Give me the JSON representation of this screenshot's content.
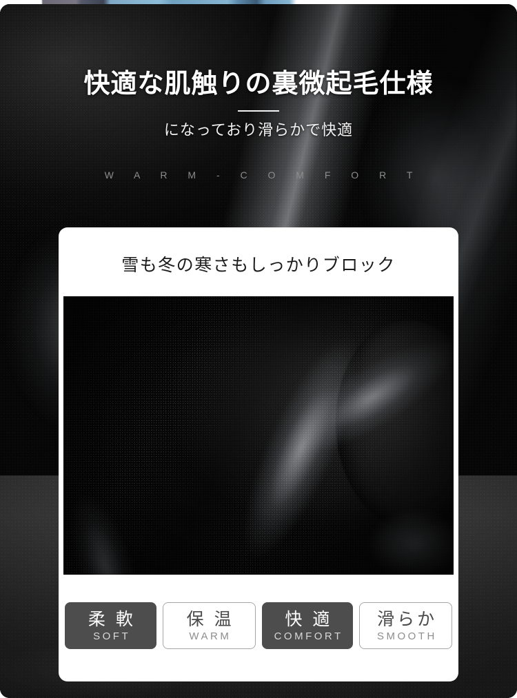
{
  "top_strip": {
    "description": "previous-image-sliver"
  },
  "hero": {
    "headline": "快適な肌触りの裏微起毛仕様",
    "subheadline": "になっており滑らかで快適",
    "eyebrow": "W A R M - C O M F O R T",
    "background_color": "#0b0b0b"
  },
  "card": {
    "title": "雪も冬の寒さもしっかりブロック",
    "background_color": "#ffffff",
    "photo_alt": "black-fleece-fabric-closeup",
    "badges": [
      {
        "jp": "柔 軟",
        "en": "SOFT",
        "style": "dark",
        "fill": "#4d4d4d"
      },
      {
        "jp": "保 温",
        "en": "WARM",
        "style": "light",
        "fill": "#ffffff"
      },
      {
        "jp": "快 適",
        "en": "COMFORT",
        "style": "dark",
        "fill": "#4d4d4d"
      },
      {
        "jp": "滑らか",
        "en": "SMOOTH",
        "style": "light",
        "fill": "#ffffff"
      }
    ]
  }
}
